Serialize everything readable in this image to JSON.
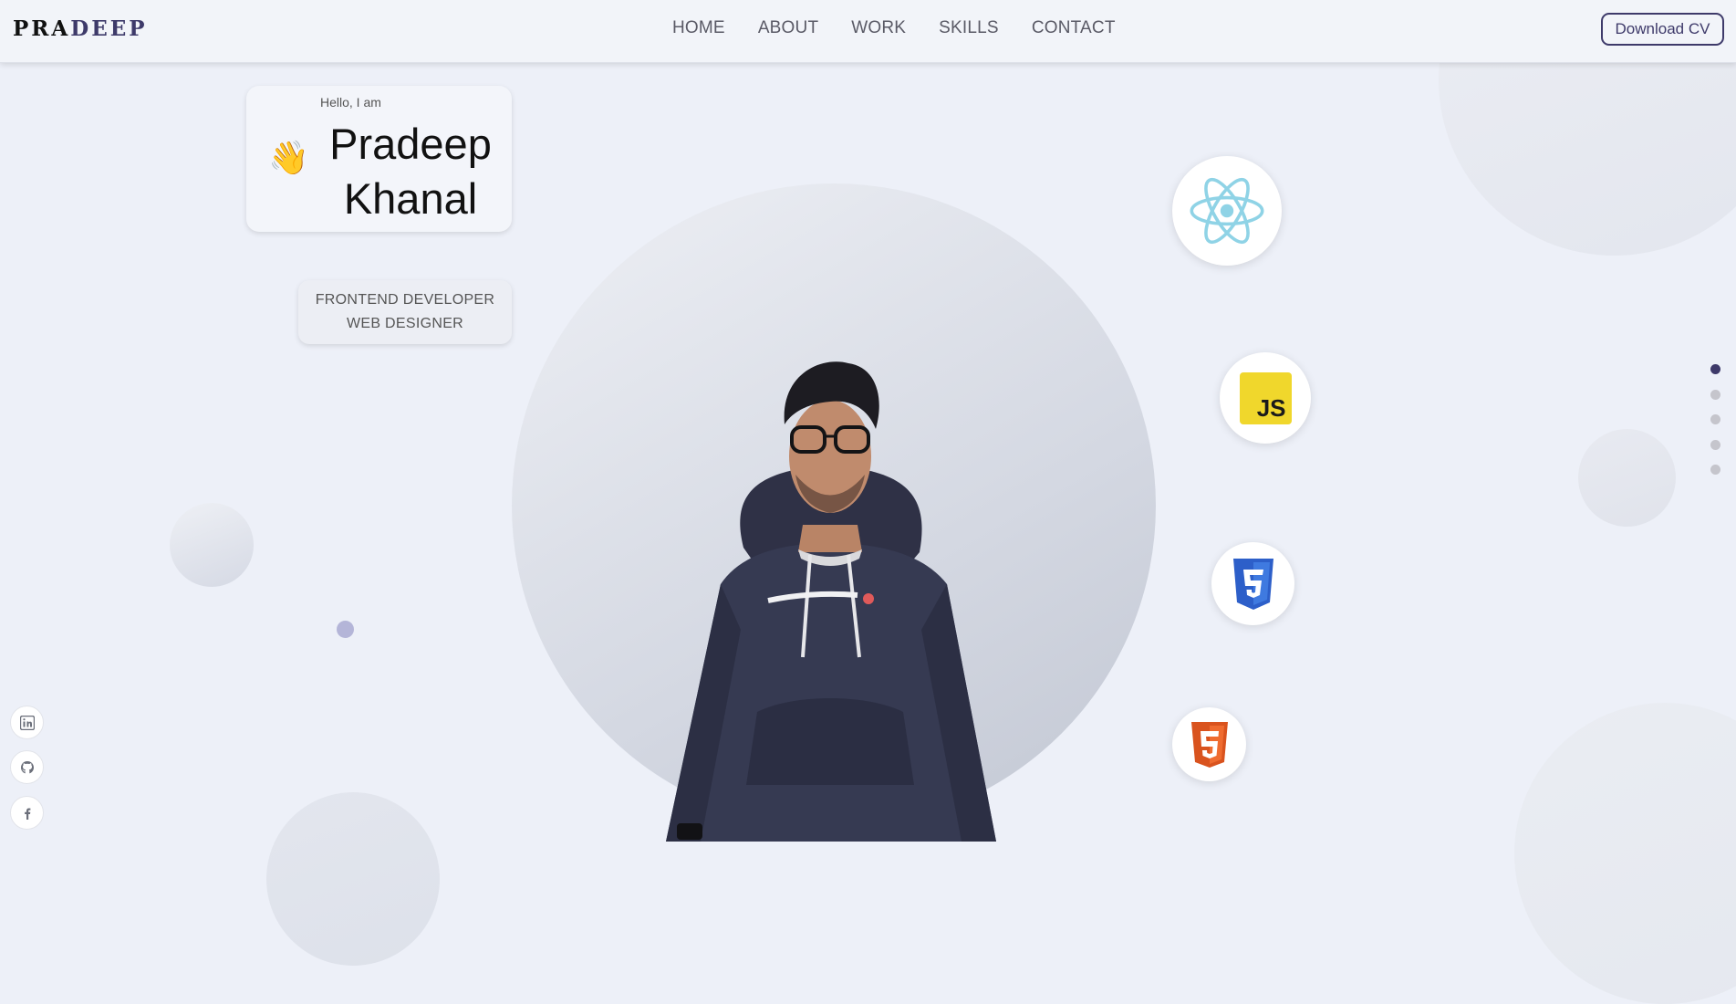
{
  "nav": {
    "logo_part1": "PRA",
    "logo_part2": "DEEP",
    "links": [
      "HOME",
      "ABOUT",
      "WORK",
      "SKILLS",
      "CONTACT"
    ],
    "cta": "Download CV"
  },
  "hero": {
    "greeting": "Hello, I am",
    "name_line1": "Pradeep",
    "name_line2": "Khanal",
    "wave_emoji": "👋",
    "roles": [
      "FRONTEND DEVELOPER",
      "WEB DESIGNER"
    ]
  },
  "skills": [
    {
      "name": "React",
      "icon": "react-icon"
    },
    {
      "name": "JavaScript",
      "icon": "javascript-icon",
      "badge_text": "JS"
    },
    {
      "name": "CSS3",
      "icon": "css3-icon"
    },
    {
      "name": "HTML5",
      "icon": "html5-icon"
    }
  ],
  "pagination": {
    "count": 5,
    "active_index": 0
  },
  "social": [
    {
      "name": "LinkedIn",
      "icon": "linkedin-icon"
    },
    {
      "name": "GitHub",
      "icon": "github-icon"
    },
    {
      "name": "Facebook",
      "icon": "facebook-icon"
    }
  ],
  "colors": {
    "background": "#edf0f8",
    "accent": "#3e3a6a",
    "react": "#61dafb",
    "javascript": "#f0d72c",
    "css3": "#264de4",
    "html5": "#e34f26"
  }
}
